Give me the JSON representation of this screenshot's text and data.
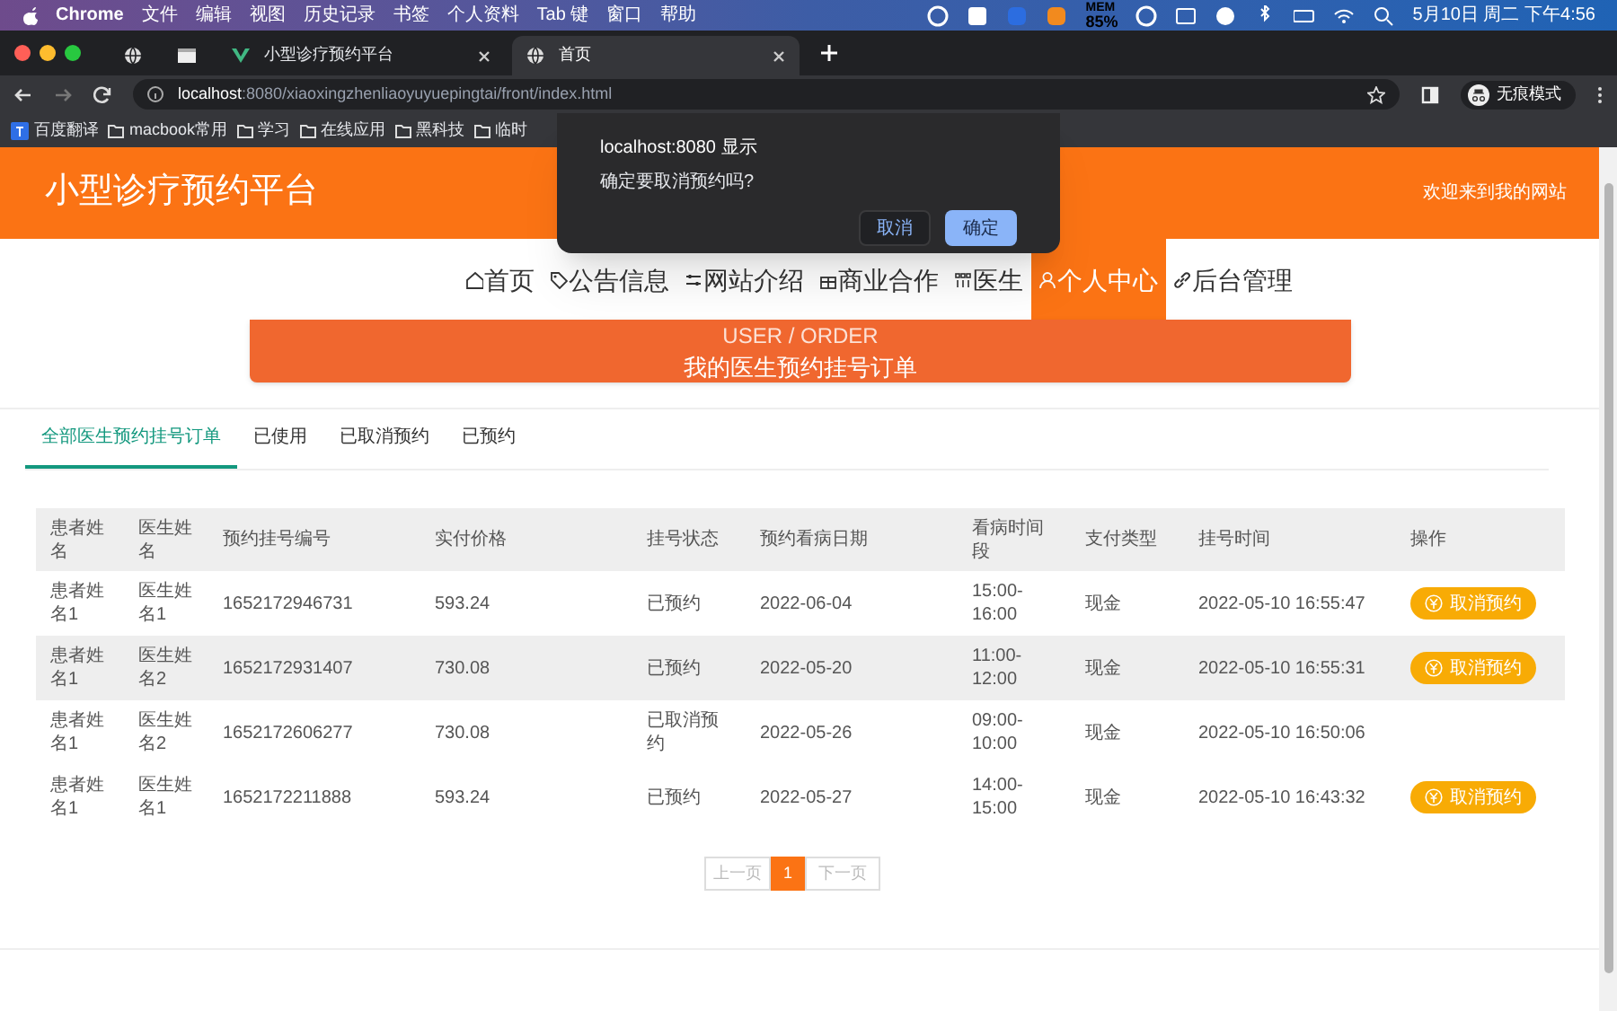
{
  "menubar": {
    "app": "Chrome",
    "menus": [
      "文件",
      "编辑",
      "视图",
      "历史记录",
      "书签",
      "个人资料",
      "Tab 键",
      "窗口",
      "帮助"
    ],
    "mem": "MEM",
    "mem_value": "85%",
    "clock": "5月10日 周二 下午4:56"
  },
  "browser": {
    "tabs": [
      {
        "kind": "globe",
        "selected": false
      },
      {
        "kind": "blank",
        "selected": false
      },
      {
        "kind": "vue",
        "title": "小型诊疗预约平台",
        "selected": false
      },
      {
        "kind": "globe",
        "title": "首页",
        "selected": true
      }
    ],
    "url_host": "localhost",
    "url_path": ":8080/xiaoxingzhenliaoyuyuepingtai/front/index.html",
    "profile_label": "无痕模式",
    "bookmarks": [
      {
        "kind": "translate",
        "label": "百度翻译"
      },
      {
        "kind": "folder",
        "label": "macbook常用"
      },
      {
        "kind": "folder",
        "label": "学习"
      },
      {
        "kind": "folder",
        "label": "在线应用"
      },
      {
        "kind": "folder",
        "label": "黑科技"
      },
      {
        "kind": "folder",
        "label": "临时"
      }
    ]
  },
  "dialog": {
    "title": "localhost:8080 显示",
    "message": "确定要取消预约吗?",
    "buttons": [
      {
        "label": "取消",
        "kind": "secondary"
      },
      {
        "label": "确定",
        "kind": "primary"
      }
    ]
  },
  "site": {
    "title": "小型诊疗预约平台",
    "welcome": "欢迎来到我的网站",
    "nav": [
      {
        "kind": "home",
        "label": "首页",
        "selected": false
      },
      {
        "kind": "tag",
        "label": "公告信息",
        "selected": false
      },
      {
        "kind": "sliders",
        "label": "网站介绍",
        "selected": false
      },
      {
        "kind": "gift",
        "label": "商业合作",
        "selected": false
      },
      {
        "kind": "grid",
        "label": "医生",
        "selected": false
      },
      {
        "kind": "user",
        "label": "个人中心",
        "selected": true
      },
      {
        "kind": "link",
        "label": "后台管理",
        "selected": false
      }
    ],
    "banner": {
      "subtitle": "USER / ORDER",
      "title": "我的医生预约挂号订单"
    },
    "order_tabs": [
      {
        "label": "全部医生预约挂号订单",
        "selected": true
      },
      {
        "label": "已使用",
        "selected": false
      },
      {
        "label": "已取消预约",
        "selected": false
      },
      {
        "label": "已预约",
        "selected": false
      }
    ],
    "table": {
      "columns": [
        "患者姓名",
        "医生姓名",
        "预约挂号编号",
        "实付价格",
        "挂号状态",
        "预约看病日期",
        "看病时间段",
        "支付类型",
        "挂号时间",
        "操作"
      ],
      "rows": [
        {
          "highlighted": false,
          "cells": [
            "患者姓名1",
            "医生姓名1",
            "1652172946731",
            "593.24",
            "已预约",
            "2022-06-04",
            "15:00-16:00",
            "现金",
            "2022-05-10 16:55:47"
          ],
          "action": "取消预约"
        },
        {
          "highlighted": true,
          "cells": [
            "患者姓名1",
            "医生姓名2",
            "1652172931407",
            "730.08",
            "已预约",
            "2022-05-20",
            "11:00-12:00",
            "现金",
            "2022-05-10 16:55:31"
          ],
          "action": "取消预约"
        },
        {
          "highlighted": false,
          "cells": [
            "患者姓名1",
            "医生姓名2",
            "1652172606277",
            "730.08",
            "已取消预约",
            "2022-05-26",
            "09:00-10:00",
            "现金",
            "2022-05-10 16:50:06"
          ]
        },
        {
          "highlighted": false,
          "cells": [
            "患者姓名1",
            "医生姓名1",
            "1652172211888",
            "593.24",
            "已预约",
            "2022-05-27",
            "14:00-15:00",
            "现金",
            "2022-05-10 16:43:32"
          ],
          "action": "取消预约"
        }
      ]
    },
    "pagination": {
      "prev": "上一页",
      "pages": [
        {
          "label": "1",
          "selected": true
        }
      ],
      "next": "下一页"
    }
  }
}
